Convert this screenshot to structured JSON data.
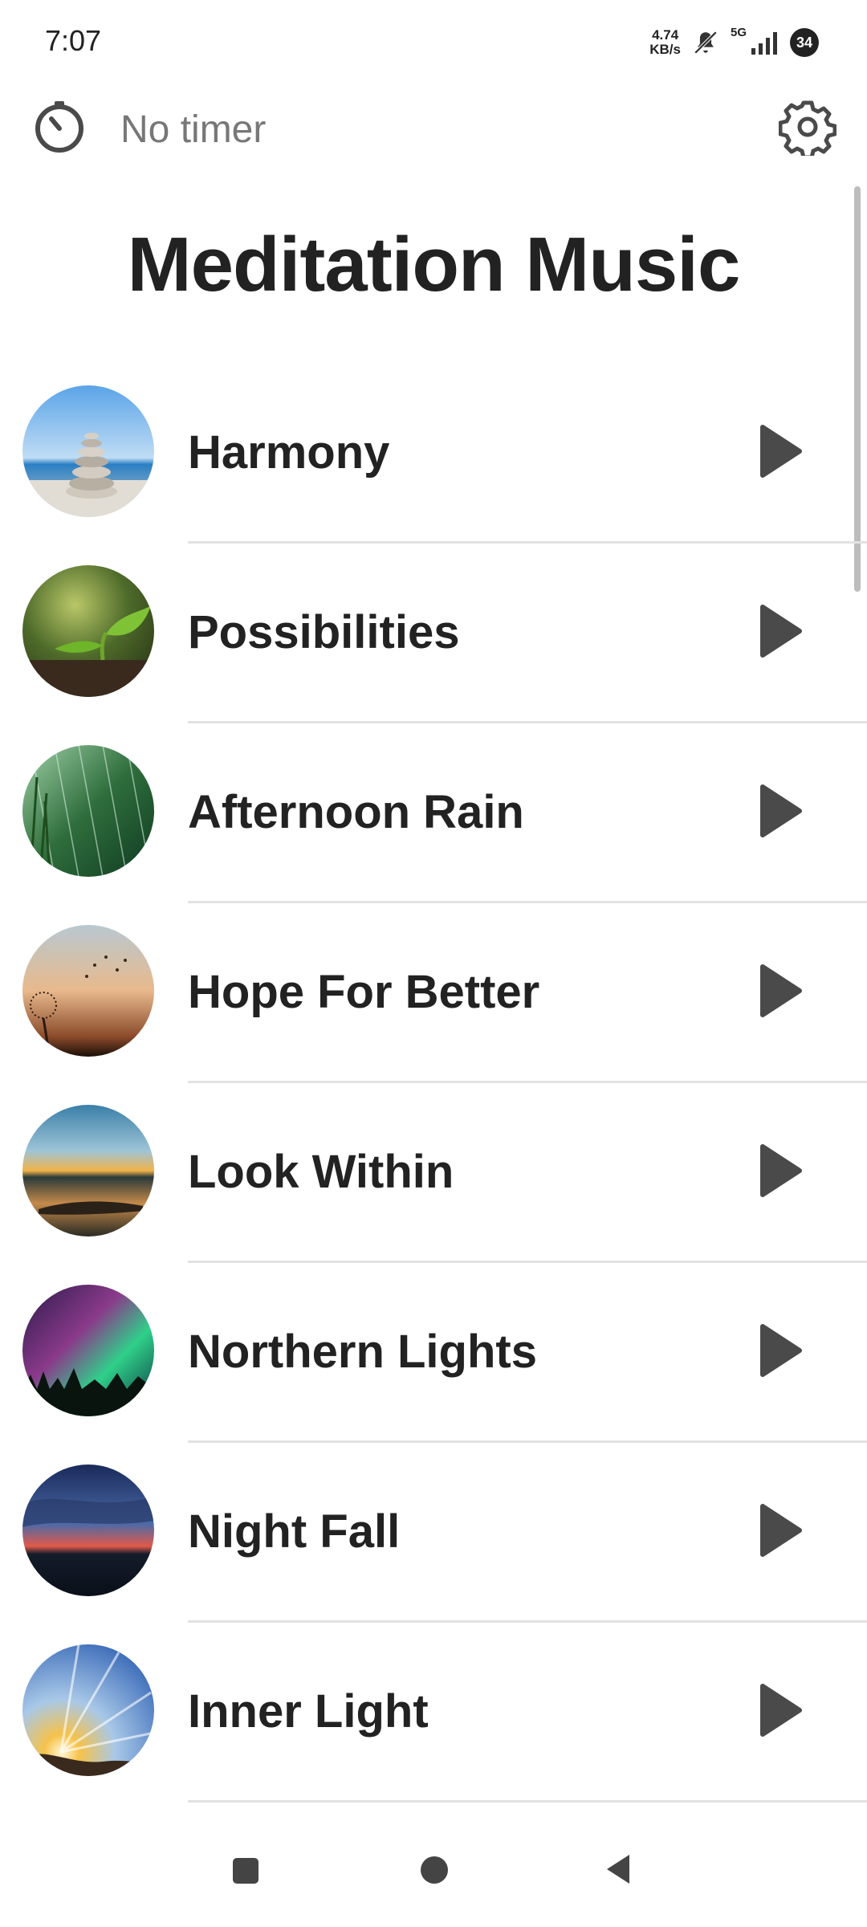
{
  "status_bar": {
    "time": "7:07",
    "net_speed_value": "4.74",
    "net_speed_unit": "KB/s",
    "network": "5G",
    "battery": "34"
  },
  "topbar": {
    "timer_label": "No timer",
    "timer_icon": "stopwatch-icon",
    "settings_icon": "gear-icon"
  },
  "page": {
    "title": "Meditation Music"
  },
  "tracks": [
    {
      "label": "Harmony",
      "icon": "play-icon"
    },
    {
      "label": "Possibilities",
      "icon": "play-icon"
    },
    {
      "label": "Afternoon Rain",
      "icon": "play-icon"
    },
    {
      "label": "Hope For Better",
      "icon": "play-icon"
    },
    {
      "label": "Look Within",
      "icon": "play-icon"
    },
    {
      "label": "Northern Lights",
      "icon": "play-icon"
    },
    {
      "label": "Night Fall",
      "icon": "play-icon"
    },
    {
      "label": "Inner Light",
      "icon": "play-icon"
    }
  ],
  "colors": {
    "text": "#222222",
    "muted": "#777777",
    "icon": "#4a4a4a",
    "divider": "#e2e2e2"
  }
}
